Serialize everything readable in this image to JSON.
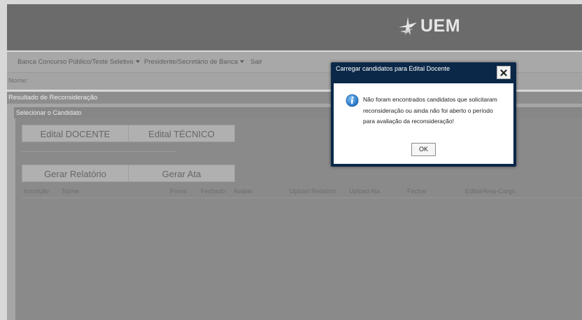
{
  "header": {
    "logo_text": "UEM"
  },
  "menu": {
    "items": [
      {
        "label": "Banca Concurso Público/Teste Seletivo",
        "dropdown": true
      },
      {
        "label": "Presidente/Secretário de Banca",
        "dropdown": true
      },
      {
        "label": "Sair",
        "dropdown": false
      }
    ]
  },
  "user": {
    "name_label": "Nome:"
  },
  "panel": {
    "title": "Resultado de Reconsideração",
    "sub_title": "Selecionar o Candidato"
  },
  "buttons": {
    "edital_docente": "Edital DOCENTE",
    "edital_tecnico": "Edital TÉCNICO",
    "gerar_relatorio": "Gerar Relatório",
    "gerar_ata": "Gerar Ata"
  },
  "table": {
    "columns": [
      "Inscrição",
      "Nome",
      "Prova",
      "Fechado",
      "Avaliar",
      "Upload Relatório",
      "Upload Ata",
      "Fechar",
      "Edital/Área-Cargo"
    ],
    "rows": []
  },
  "dialog": {
    "title": "Carregar candidatos para Edital Docente",
    "message": "Não foram encontrados candidatos que solicitaram reconsideração ou ainda não foi aberto o período para avaliação da reconsideração!",
    "ok_label": "OK",
    "icon": "info-icon"
  },
  "colors": {
    "dialog_header": "#0b2848",
    "banner": "#6b6b6b",
    "info_icon": "#2a7fd0"
  }
}
